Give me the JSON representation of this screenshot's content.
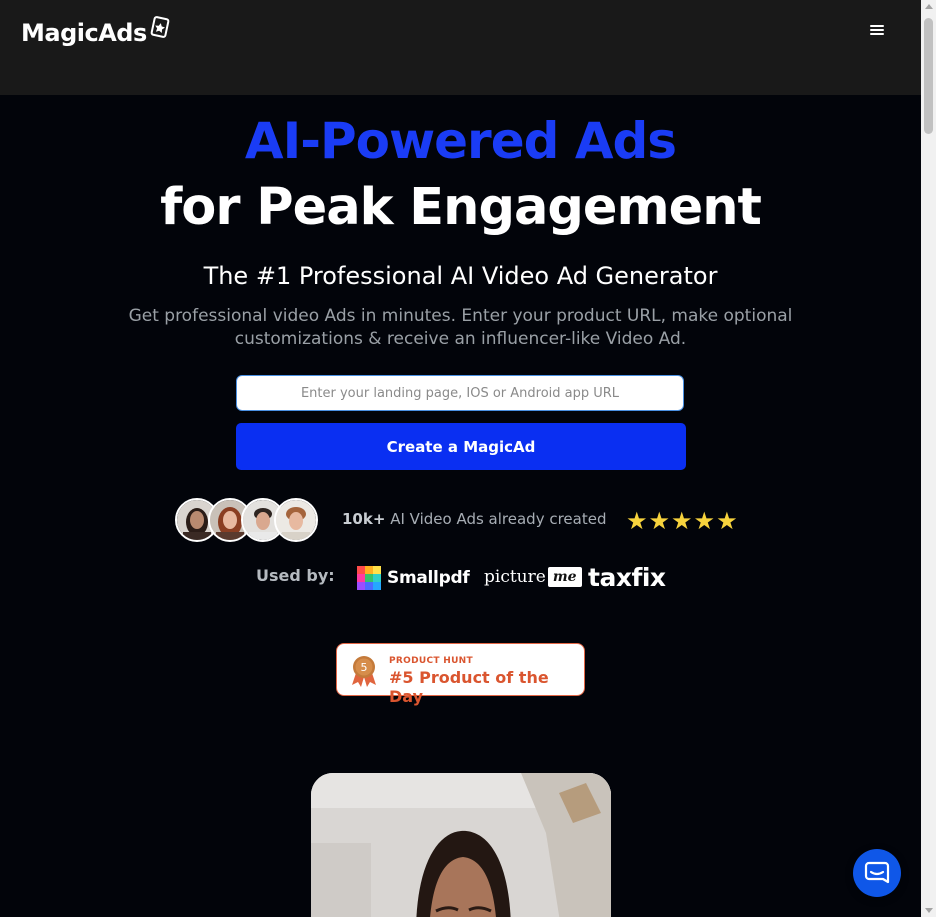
{
  "header": {
    "logo_text": "MagicAds",
    "logo_icon": "cards-icon",
    "menu_icon": "hamburger-menu-icon"
  },
  "hero": {
    "title_line1": "AI-Powered Ads",
    "title_line2": "for Peak Engagement",
    "subtitle": "The #1 Professional AI Video Ad Generator",
    "description": "Get professional video Ads in minutes. Enter your product URL, make optional customizations & receive an influencer-like Video Ad."
  },
  "form": {
    "url_placeholder": "Enter your landing page, IOS or Android app URL",
    "cta_label": "Create a MagicAd"
  },
  "social_proof": {
    "count": "10k+",
    "text": "AI Video Ads already created",
    "stars": "★★★★★",
    "rating": 5
  },
  "used_by": {
    "label": "Used by:",
    "brands": [
      "Smallpdf",
      "picture",
      "me",
      "taxfix"
    ]
  },
  "product_hunt": {
    "small": "PRODUCT HUNT",
    "big": "#5 Product of the Day",
    "rank": "5"
  },
  "colors": {
    "accent_blue": "#1a3cf5",
    "cta_blue": "#0a2ff2",
    "background": "#02040a",
    "header_bg": "#191919",
    "star": "#f7d33d",
    "product_hunt": "#da552f",
    "chat": "#0f57e8"
  },
  "chat": {
    "icon": "chat-bubble-icon"
  }
}
